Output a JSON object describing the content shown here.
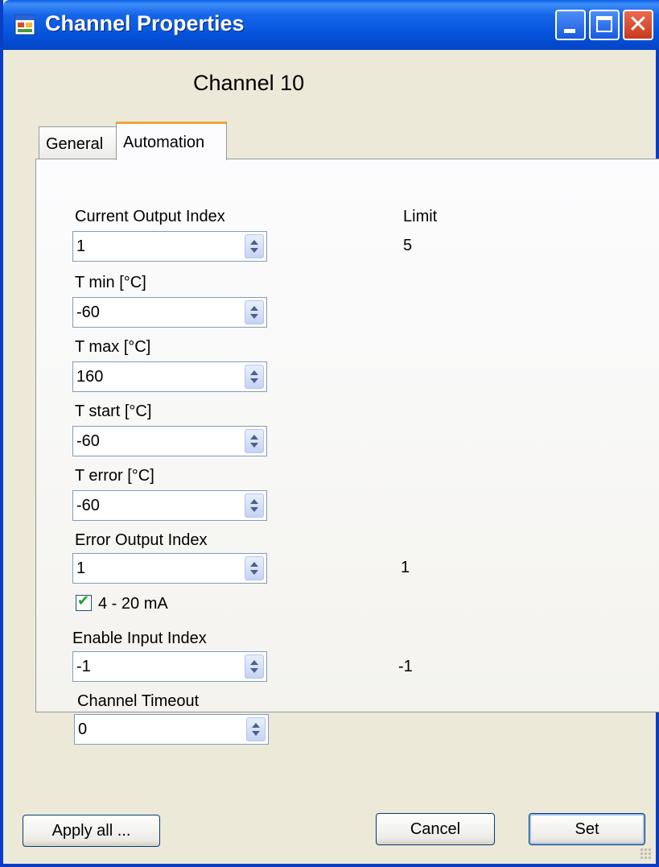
{
  "window": {
    "title": "Channel Properties",
    "minimize_icon": "minimize-icon",
    "maximize_icon": "maximize-icon",
    "close_icon": "close-icon",
    "close_glyph": "✕"
  },
  "header": {
    "channel_title": "Channel 10"
  },
  "tabs": [
    {
      "label": "General",
      "active": false
    },
    {
      "label": "Automation",
      "active": true
    }
  ],
  "automation": {
    "limit_label": "Limit",
    "current_output_index": {
      "label": "Current Output Index",
      "value": "1",
      "limit": "5"
    },
    "t_min": {
      "label": "T min [°C]",
      "value": "-60"
    },
    "t_max": {
      "label": "T max [°C]",
      "value": "160"
    },
    "t_start": {
      "label": "T start [°C]",
      "value": "-60"
    },
    "t_error": {
      "label": "T error [°C]",
      "value": "-60"
    },
    "error_output_index": {
      "label": "Error Output Index",
      "value": "1",
      "limit": "1"
    },
    "four_twenty_ma": {
      "label": "4 - 20 mA",
      "checked": true,
      "check_glyph": "✔"
    },
    "enable_input_index": {
      "label": "Enable Input Index",
      "value": "-1",
      "limit": "-1"
    },
    "channel_timeout": {
      "label": "Channel Timeout",
      "value": "0"
    }
  },
  "buttons": {
    "apply_all": "Apply all ...",
    "cancel": "Cancel",
    "set": "Set"
  },
  "colors": {
    "titlebar": "#0553db",
    "dialog_bg": "#ece9d8",
    "active_tab_accent": "#f2a33a",
    "checkmark": "#21a121"
  }
}
